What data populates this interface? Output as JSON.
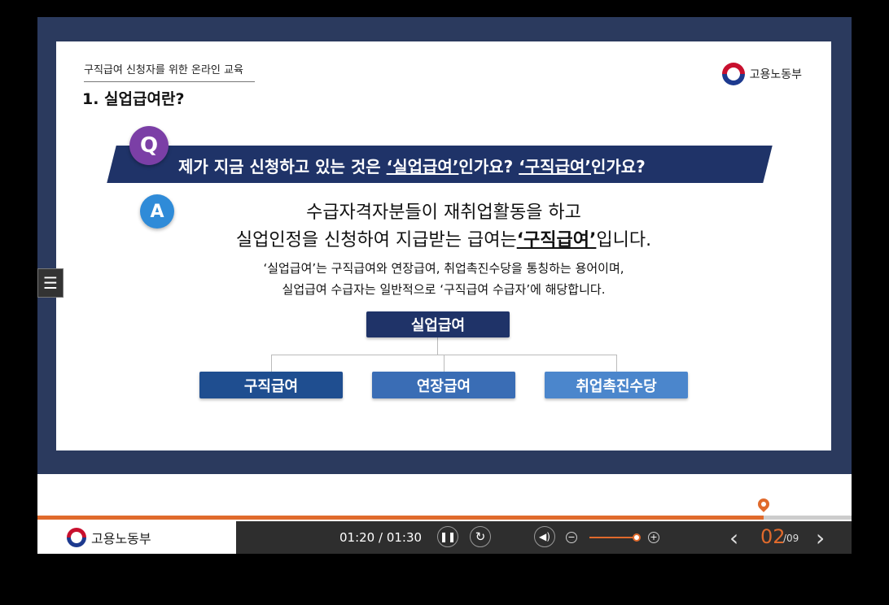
{
  "slide": {
    "course_title": "구직급여 신청자를 위한 온라인 교육",
    "section_title": "1. 실업급여란?",
    "brand": "고용노동부",
    "question": {
      "badge": "Q",
      "prefix": "제가 지금 신청하고 있는 것은 ",
      "term1": "‘실업급여’",
      "mid": "인가요?  ",
      "term2": "‘구직급여’",
      "suffix": "인가요?"
    },
    "answer": {
      "badge": "A",
      "line1": "수급자격자분들이 재취업활동을 하고",
      "line2_prefix": "실업인정을 신청하여 지급받는 급여는",
      "line2_term": "‘구직급여’",
      "line2_suffix": "입니다.",
      "detail1": "‘실업급여’는 구직급여와 연장급여, 취업촉진수당을 통칭하는 용어이며,",
      "detail2": "실업급여 수급자는 일반적으로 ‘구직급여 수급자’에 해당합니다."
    },
    "diagram": {
      "root": "실업급여",
      "children": [
        "구직급여",
        "연장급여",
        "취업촉진수당"
      ]
    }
  },
  "player": {
    "menu_icon": "hamburger-icon",
    "brand": "고용노동부",
    "time": "01:20 / 01:30",
    "progress_fraction": 0.892,
    "volume_fraction": 0.9,
    "page_current": "02",
    "page_total": "/09",
    "accent_color": "#e06a2c"
  }
}
